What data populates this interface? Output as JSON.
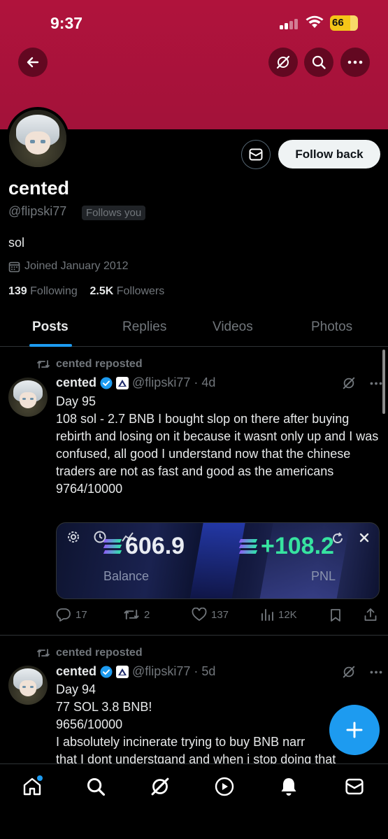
{
  "status_bar": {
    "time": "9:37",
    "battery": "66"
  },
  "profile": {
    "name": "cented",
    "handle": "@flipski77",
    "follows_you": "Follows you",
    "bio": "sol",
    "joined": "Joined January 2012",
    "following_count": "139",
    "following_label": "Following",
    "followers_count": "2.5K",
    "followers_label": "Followers",
    "follow_button": "Follow back"
  },
  "tabs": [
    {
      "label": "Posts",
      "active": true
    },
    {
      "label": "Replies",
      "active": false
    },
    {
      "label": "Videos",
      "active": false
    },
    {
      "label": "Photos",
      "active": false
    }
  ],
  "posts": [
    {
      "repost_label": "cented reposted",
      "author": "cented",
      "handle_time": "@flipski77 · 4d",
      "text": "Day 95\n108 sol - 2.7 BNB I bought slop on there after buying rebirth and losing on it because it wasnt only up and I was confused, all good I understand now that the chinese traders are not as fast and good as the americans\n9764/10000",
      "media": {
        "balance_value": "606.9",
        "balance_label": "Balance",
        "pnl_value": "+108.2",
        "pnl_label": "PNL"
      },
      "actions": {
        "replies": "17",
        "reposts": "2",
        "likes": "137",
        "views": "12K"
      }
    },
    {
      "repost_label": "cented reposted",
      "author": "cented",
      "handle_time": "@flipski77 · 5d",
      "text": "Day 94\n77 SOL 3.8 BNB!\n9656/10000\nI absolutely incinerate trying to buy BNB narr\nthat I dont understgand and when i stop doing that"
    }
  ],
  "colors": {
    "banner": "#a3123a",
    "accent": "#1d9bf0",
    "pnl_green": "#37e3a0"
  },
  "icons": [
    "back-arrow-icon",
    "grok-icon",
    "search-icon",
    "more-icon",
    "mail-icon",
    "calendar-icon",
    "repost-icon",
    "verified-icon",
    "reply-icon",
    "like-icon",
    "views-icon",
    "bookmark-icon",
    "share-icon",
    "home-icon",
    "bell-icon",
    "play-icon",
    "plus-icon"
  ]
}
